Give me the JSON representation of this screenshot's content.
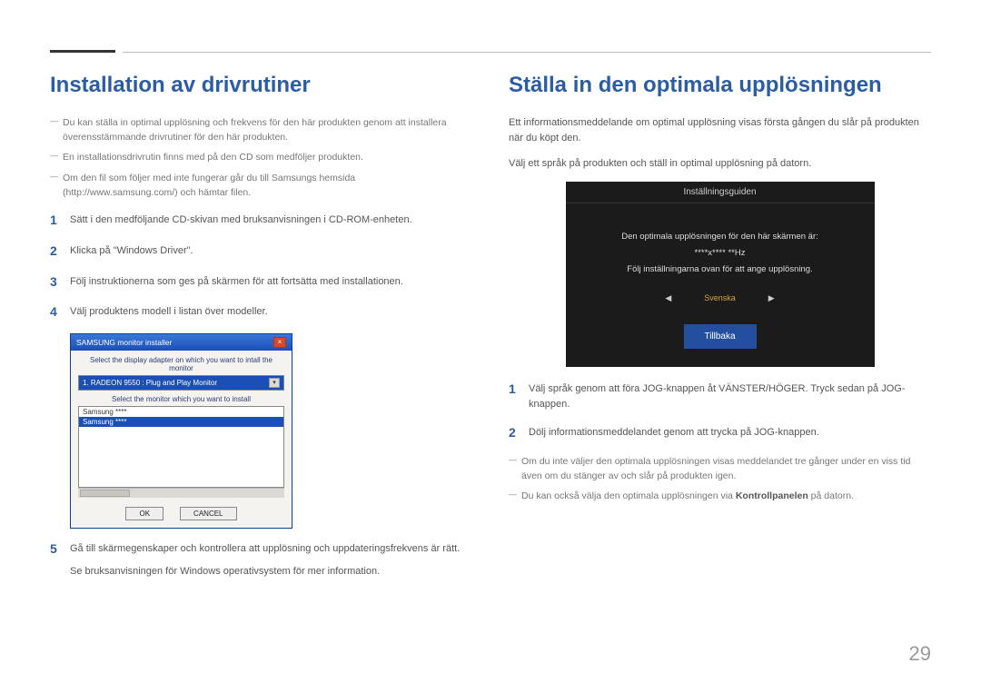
{
  "page_number": "29",
  "left": {
    "heading": "Installation av drivrutiner",
    "notes": [
      "Du kan ställa in optimal upplösning och frekvens för den här produkten genom att installera överensstämmande drivrutiner för den här produkten.",
      "En installationsdrivrutin finns med på den CD som medföljer produkten.",
      "Om den fil som följer med inte fungerar går du till Samsungs hemsida (http://www.samsung.com/) och hämtar filen."
    ],
    "steps": {
      "s1": "Sätt i den medföljande CD-skivan med bruksanvisningen i CD-ROM-enheten.",
      "s2": "Klicka på \"Windows Driver\".",
      "s3": "Följ instruktionerna som ges på skärmen för att fortsätta med installationen.",
      "s4": "Välj produktens modell i listan över modeller.",
      "s5": "Gå till skärmegenskaper och kontrollera att upplösning och uppdateringsfrekvens är rätt.",
      "s5_sub": "Se bruksanvisningen för Windows operativsystem för mer information."
    },
    "dialog": {
      "title": "SAMSUNG monitor installer",
      "label1": "Select the display adapter on which you want to intall the monitor",
      "adapter": "1. RADEON 9550 : Plug and Play Monitor",
      "label2": "Select the monitor which you want to install",
      "list_item1": "Samsung ****",
      "list_item2": "Samsung ****",
      "ok": "OK",
      "cancel": "CANCEL"
    }
  },
  "right": {
    "heading": "Ställa in den optimala upplösningen",
    "intro1": "Ett informationsmeddelande om optimal upplösning visas första gången du slår på produkten när du köpt den.",
    "intro2": "Välj ett språk på produkten och ställ in optimal upplösning på datorn.",
    "osd": {
      "title": "Inställningsguiden",
      "line1": "Den optimala upplösningen för den här skärmen är:",
      "line2": "****x**** **Hz",
      "line3": "Följ inställningarna ovan för att ange upplösning.",
      "language": "Svenska",
      "back": "Tillbaka"
    },
    "steps": {
      "s1": "Välj språk genom att föra JOG-knappen åt VÄNSTER/HÖGER. Tryck sedan på JOG-knappen.",
      "s2": "Dölj informationsmeddelandet genom att trycka på JOG-knappen."
    },
    "notes": {
      "n1": "Om du inte väljer den optimala upplösningen visas meddelandet tre gånger under en viss tid även om du stänger av och slår på produkten igen.",
      "n2_pre": "Du kan också välja den optimala upplösningen via ",
      "n2_bold": "Kontrollpanelen",
      "n2_post": " på datorn."
    }
  }
}
